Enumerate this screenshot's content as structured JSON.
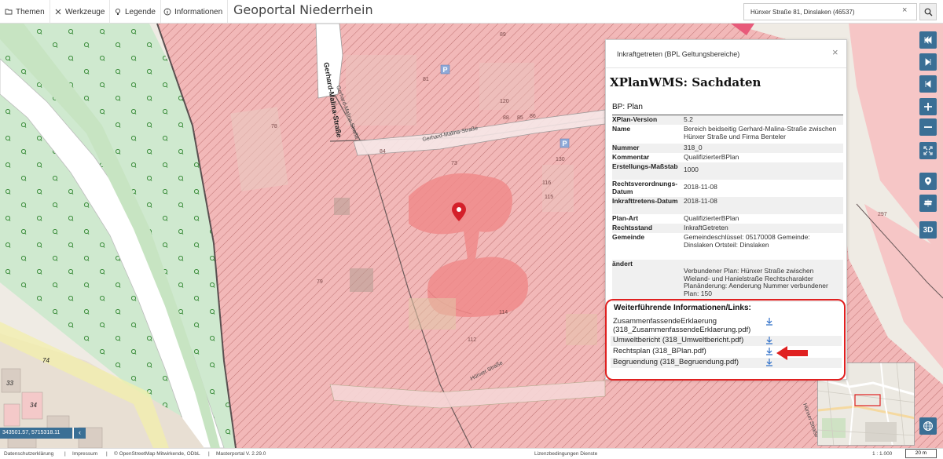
{
  "topbar": {
    "menu": [
      {
        "label": "Themen",
        "icon": "folder-icon"
      },
      {
        "label": "Werkzeuge",
        "icon": "tools-icon"
      },
      {
        "label": "Legende",
        "icon": "lightbulb-icon"
      },
      {
        "label": "Informationen",
        "icon": "info-icon"
      }
    ],
    "title": "Geoportal Niederrhein",
    "search_value": "Hünxer Straße 81, Dinslaken (46537)",
    "clear_symbol": "×"
  },
  "map": {
    "street_labels": [
      "Gerhard-Malina-Straße",
      "Gerhard-Malina-Straße",
      "Gerhard-Malina-Straße",
      "Hünxer Straße",
      "Hünxer Straße"
    ],
    "house_numbers": [
      "89",
      "81",
      "78",
      "84",
      "73",
      "120",
      "88",
      "85",
      "86",
      "130",
      "116",
      "115",
      "79",
      "114",
      "112",
      "297",
      "74",
      "33",
      "34"
    ],
    "colors": {
      "plan_area": "#f2b8b8",
      "hatch": "#8a2a2a",
      "green": "#cfe9cf",
      "water": "#ffffff",
      "marker": "#d4202a"
    }
  },
  "controls": [
    {
      "name": "first-page-button",
      "icon": "skip-start-icon"
    },
    {
      "name": "last-page-button",
      "icon": "skip-end-icon"
    },
    {
      "name": "back-button",
      "icon": "skip-back-icon"
    },
    {
      "name": "zoom-in-button",
      "icon": "plus-icon"
    },
    {
      "name": "zoom-out-button",
      "icon": "minus-icon"
    },
    {
      "name": "fullscreen-button",
      "icon": "expand-icon"
    },
    {
      "name": "locate-button",
      "icon": "location-pin-icon"
    },
    {
      "name": "signpost-button",
      "icon": "signpost-icon"
    },
    {
      "name": "3d-button",
      "label": "3D"
    }
  ],
  "popup": {
    "title": "Inkraftgetreten (BPL Geltungsbereiche)",
    "close_symbol": "×",
    "heading": "XPlanWMS: Sachdaten",
    "subheading": "BP: Plan",
    "rows": [
      {
        "key": "XPlan-Version",
        "value": "5.2"
      },
      {
        "key": "Name",
        "value": "Bereich beidseitig Gerhard-Malina-Straße zwischen Hünxer Straße und Firma Benteler"
      },
      {
        "key": "Nummer",
        "value": "318_0"
      },
      {
        "key": "Kommentar",
        "value": "QualifizierterBPlan"
      },
      {
        "key": "Erstellungs-Maßstab",
        "value": "1000"
      },
      {
        "key": "Rechtsverordnungs-Datum",
        "value": "2018-11-08"
      },
      {
        "key": "Inkrafttretens-Datum",
        "value": "2018-11-08"
      },
      {
        "key": "Plan-Art",
        "value": "QualifizierterBPlan"
      },
      {
        "key": "Rechtsstand",
        "value": "InkraftGetreten"
      },
      {
        "key": "Gemeinde",
        "value": "Gemeindeschlüssel: 05170008 Gemeinde: Dinslaken Ortsteil: Dinslaken"
      },
      {
        "key": "ändert",
        "value": "Verbundener Plan: Hünxer Straße zwischen Wieland- und Hanielstraße Rechtscharakter Planänderung: Aenderung Nummer verbundener Plan: 150"
      }
    ],
    "links_title": "Weiterführende Informationen/Links:",
    "links": [
      {
        "label": "ZusammenfassendeErklaerung (318_ZusammenfassendeErklaerung.pdf)"
      },
      {
        "label": "Umweltbericht (318_Umweltbericht.pdf)"
      },
      {
        "label": "Rechtsplan (318_BPlan.pdf)"
      },
      {
        "label": "Begruendung (318_Begruendung.pdf)"
      }
    ]
  },
  "coords": {
    "value": "343501.57, 5715318.11",
    "toggle": "‹"
  },
  "footer": {
    "items": [
      "Datenschutzerklärung",
      "|",
      "Impressum",
      "|",
      "© OpenStreetMap Mitwirkende, ODbL",
      "|",
      "Masterportal V. 2.29.0"
    ],
    "license": "Lizenzbedingungen Dienste",
    "scale": "1 : 1.000",
    "scale_bar": "20 m"
  }
}
